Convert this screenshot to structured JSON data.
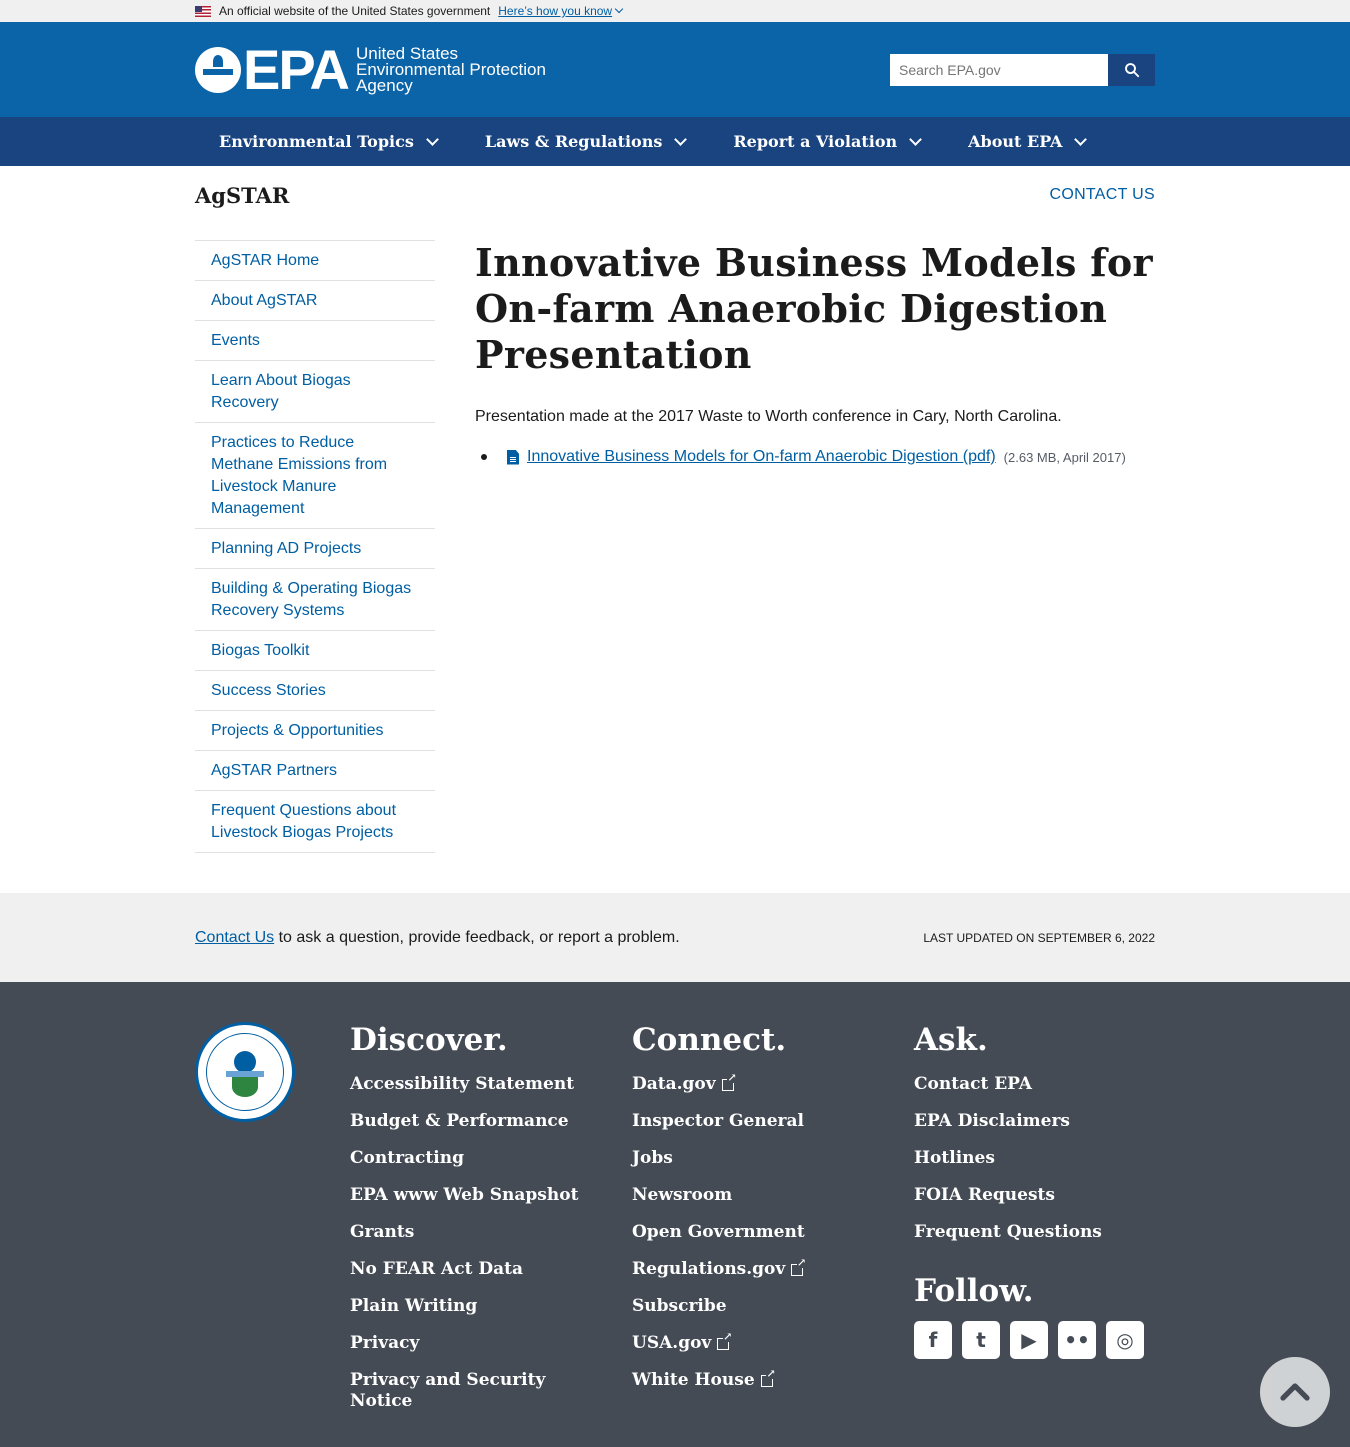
{
  "gov_banner": {
    "text": "An official website of the United States government",
    "link": "Here’s how you know"
  },
  "header": {
    "logo_acronym": "EPA",
    "logo_line1": "United States",
    "logo_line2": "Environmental Protection",
    "logo_line3": "Agency",
    "search_placeholder": "Search EPA.gov"
  },
  "nav": [
    {
      "label": "Environmental Topics"
    },
    {
      "label": "Laws & Regulations"
    },
    {
      "label": "Report a Violation"
    },
    {
      "label": "About EPA"
    }
  ],
  "subhead": {
    "site_name": "AgSTAR",
    "contact": "CONTACT US"
  },
  "sidenav": [
    {
      "label": "AgSTAR Home"
    },
    {
      "label": "About AgSTAR"
    },
    {
      "label": "Events"
    },
    {
      "label": "Learn About Biogas Recovery"
    },
    {
      "label": "Practices to Reduce Methane Emissions from Livestock Manure Management"
    },
    {
      "label": "Planning AD Projects"
    },
    {
      "label": "Building & Operating Biogas Recovery Systems"
    },
    {
      "label": "Biogas Toolkit"
    },
    {
      "label": "Success Stories"
    },
    {
      "label": "Projects & Opportunities"
    },
    {
      "label": "AgSTAR Partners"
    },
    {
      "label": "Frequent Questions about Livestock Biogas Projects"
    }
  ],
  "content": {
    "title": "Innovative Business Models for On-farm Anaerobic Digestion Presentation",
    "intro": "Presentation made at the 2017 Waste to Worth conference in Cary, North Carolina.",
    "file_link": "Innovative Business Models for On-farm Anaerobic Digestion (pdf)",
    "file_meta": "(2.63 MB, April 2017)"
  },
  "feedback": {
    "link": "Contact Us",
    "text": " to ask a question, provide feedback, or report a problem.",
    "updated": "LAST UPDATED ON SEPTEMBER 6, 2022"
  },
  "footer": {
    "discover": {
      "title": "Discover.",
      "links": [
        "Accessibility Statement",
        "Budget & Performance",
        "Contracting",
        "EPA www Web Snapshot",
        "Grants",
        "No FEAR Act Data",
        "Plain Writing",
        "Privacy",
        "Privacy and Security Notice"
      ]
    },
    "connect": {
      "title": "Connect.",
      "links": [
        "Data.gov",
        "Inspector General",
        "Jobs",
        "Newsroom",
        "Open Government",
        "Regulations.gov",
        "Subscribe",
        "USA.gov",
        "White House"
      ]
    },
    "ask": {
      "title": "Ask.",
      "links": [
        "Contact EPA",
        "EPA Disclaimers",
        "Hotlines",
        "FOIA Requests",
        "Frequent Questions"
      ]
    },
    "follow": {
      "title": "Follow.",
      "icons": [
        "facebook-icon",
        "twitter-icon",
        "youtube-icon",
        "flickr-icon",
        "instagram-icon"
      ]
    }
  }
}
